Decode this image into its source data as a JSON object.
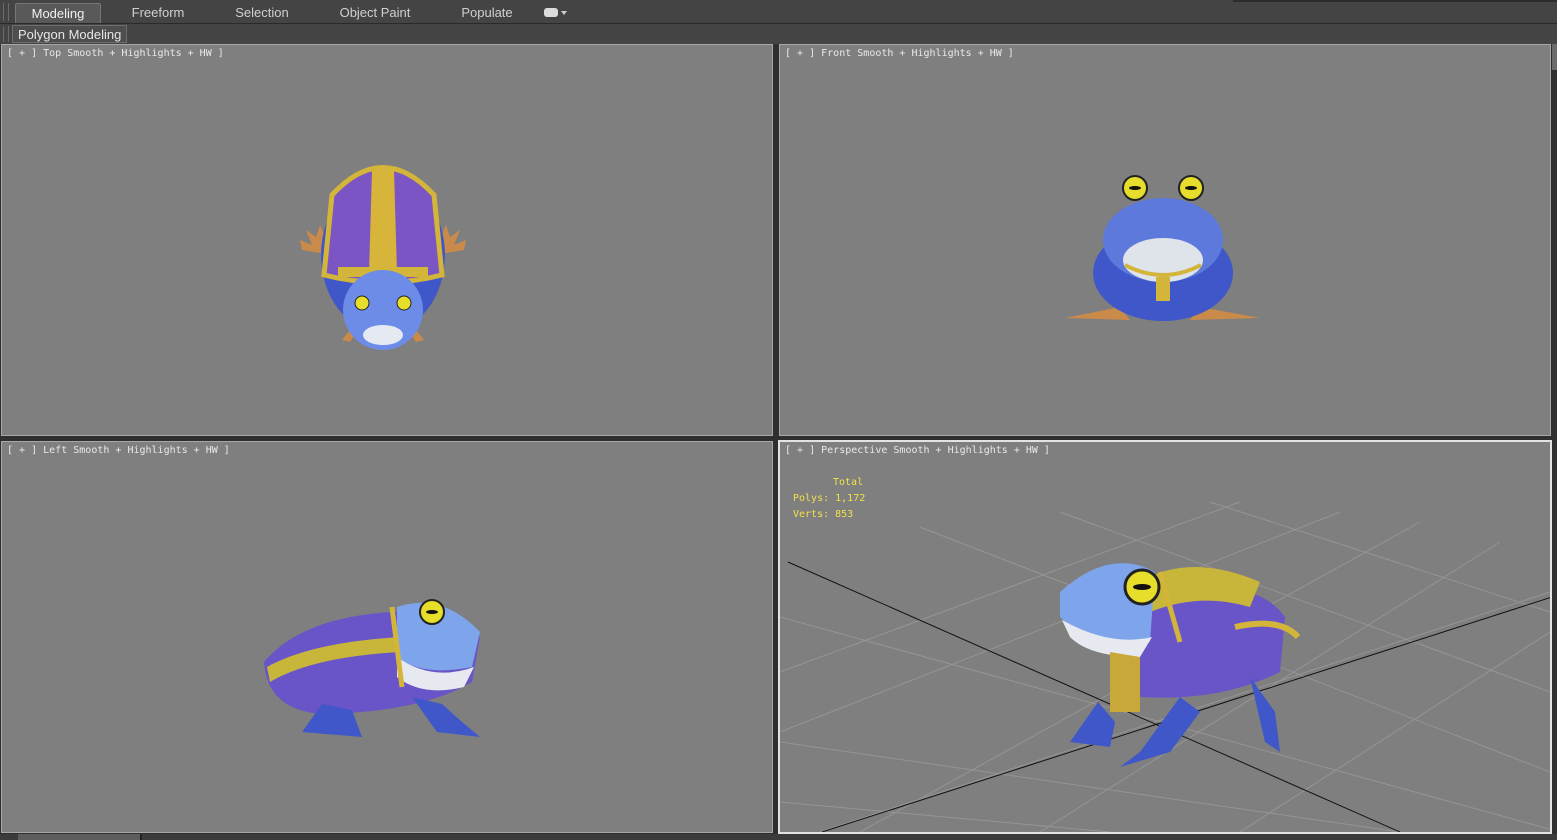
{
  "ribbon": {
    "tabs": [
      {
        "label": "Modeling",
        "active": true
      },
      {
        "label": "Freeform"
      },
      {
        "label": "Selection"
      },
      {
        "label": "Object Paint"
      },
      {
        "label": "Populate"
      }
    ],
    "dropdown_icon": "display-toggle-icon",
    "panel_label": "Polygon Modeling"
  },
  "viewports": {
    "top": {
      "plus": "[ + ]",
      "view": "Top",
      "shading": "Smooth + Highlights + HW ]"
    },
    "front": {
      "plus": "[ + ]",
      "view": "Front",
      "shading": "Smooth + Highlights + HW ]"
    },
    "left": {
      "plus": "[ + ]",
      "view": "Left",
      "shading": "Smooth + Highlights + HW ]"
    },
    "perspective": {
      "plus": "[ + ]",
      "view": "Perspective",
      "shading": "Smooth + Highlights + HW ]"
    }
  },
  "stats": {
    "header": "Total",
    "polys": "Polys: 1,172",
    "verts": "Verts: 853"
  },
  "colors": {
    "viewport_bg": "#7f7f7f",
    "stats_text": "#f1e24a",
    "frog_blue": "#3f57c8",
    "frog_purple": "#7b55c4",
    "gold": "#d3b53a"
  }
}
